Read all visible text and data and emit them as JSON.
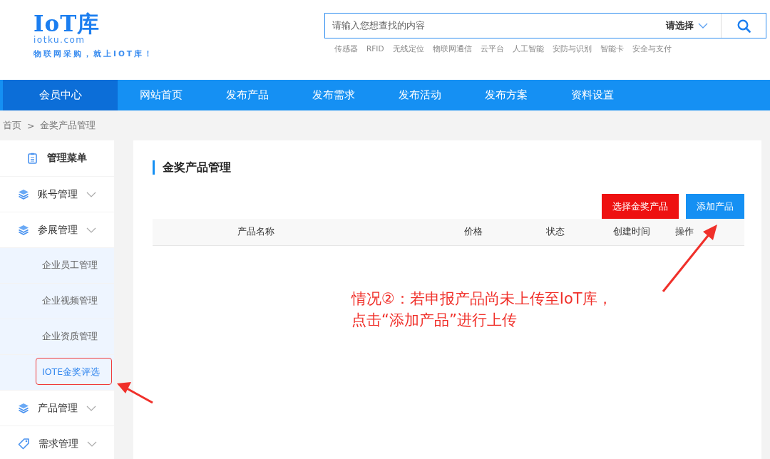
{
  "logo": {
    "name": "IoT库",
    "domain": "iotku.com",
    "slogan": "物联网采购，就上IOT库！"
  },
  "search": {
    "placeholder": "请输入您想查找的内容",
    "category": "请选择",
    "hot_tags": [
      "传感器",
      "RFID",
      "无线定位",
      "物联网通信",
      "云平台",
      "人工智能",
      "安防与识别",
      "智能卡",
      "安全与支付"
    ]
  },
  "nav": [
    {
      "label": "会员中心",
      "selected": true
    },
    {
      "label": "网站首页",
      "selected": false
    },
    {
      "label": "发布产品",
      "selected": false
    },
    {
      "label": "发布需求",
      "selected": false
    },
    {
      "label": "发布活动",
      "selected": false
    },
    {
      "label": "发布方案",
      "selected": false
    },
    {
      "label": "资料设置",
      "selected": false
    }
  ],
  "breadcrumb": [
    "首页",
    ">",
    "金奖产品管理"
  ],
  "sidebar": {
    "title": "管理菜单",
    "items": [
      {
        "label": "账号管理",
        "kind": "layers"
      },
      {
        "label": "参展管理",
        "kind": "layers",
        "children": [
          {
            "label": "企业员工管理",
            "selected": false
          },
          {
            "label": "企业视频管理",
            "selected": false
          },
          {
            "label": "企业资质管理",
            "selected": false
          },
          {
            "label": "IOTE金奖评选",
            "selected": true
          }
        ]
      },
      {
        "label": "产品管理",
        "kind": "layers"
      },
      {
        "label": "需求管理",
        "kind": "tag"
      }
    ]
  },
  "main": {
    "title": "金奖产品管理",
    "buttons": [
      {
        "label": "选择金奖产品",
        "kind": "danger"
      },
      {
        "label": "添加产品",
        "kind": "primary"
      }
    ],
    "columns": [
      "产品名称",
      "价格",
      "状态",
      "创建时间",
      "操作"
    ]
  },
  "annotation": {
    "lines": [
      "情况②：若申报产品尚未上传至IoT库，",
      "点击“添加产品”进行上传"
    ]
  }
}
